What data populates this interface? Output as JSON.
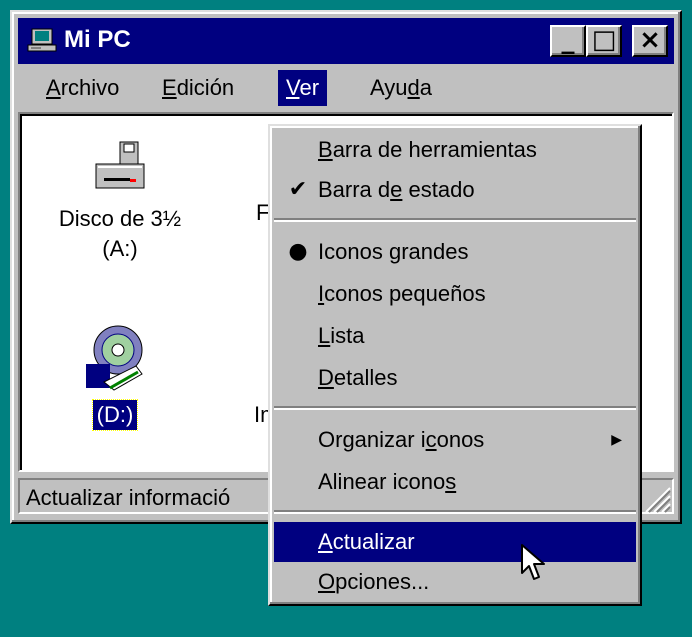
{
  "window": {
    "title": "Mi PC",
    "minimize": "_",
    "maximize": "□",
    "close": "×"
  },
  "menubar": [
    {
      "pre": "",
      "mn": "A",
      "post": "rchivo"
    },
    {
      "pre": "",
      "mn": "E",
      "post": "dición"
    },
    {
      "pre": "",
      "mn": "V",
      "post": "er"
    },
    {
      "pre": "Ayu",
      "mn": "d",
      "post": "a"
    }
  ],
  "icons": {
    "floppy": {
      "line1": "Disco de 3½",
      "line2": "(A:)"
    },
    "cd": {
      "label": "(D:)"
    },
    "partial_f": "F",
    "partial_im": "Im"
  },
  "status": {
    "text": "Actualizar informació"
  },
  "dropdown": [
    {
      "pre": "",
      "mn": "B",
      "post": "arra de herramientas",
      "mark": ""
    },
    {
      "pre": "Barra d",
      "mn": "e",
      "post": " estado",
      "mark": "✔"
    },
    {
      "pre": "Iconos ",
      "mn": "g",
      "post": "randes",
      "mark": "●"
    },
    {
      "pre": "",
      "mn": "I",
      "post": "conos pequeños",
      "mark": ""
    },
    {
      "pre": "",
      "mn": "L",
      "post": "ista",
      "mark": ""
    },
    {
      "pre": "",
      "mn": "D",
      "post": "etalles",
      "mark": ""
    },
    {
      "pre": "Organizar i",
      "mn": "c",
      "post": "onos",
      "mark": "",
      "submenu": "▶"
    },
    {
      "pre": "Alinear icono",
      "mn": "s",
      "post": "",
      "mark": ""
    },
    {
      "pre": "",
      "mn": "A",
      "post": "ctualizar",
      "mark": ""
    },
    {
      "pre": "",
      "mn": "O",
      "post": "pciones...",
      "mark": ""
    }
  ]
}
